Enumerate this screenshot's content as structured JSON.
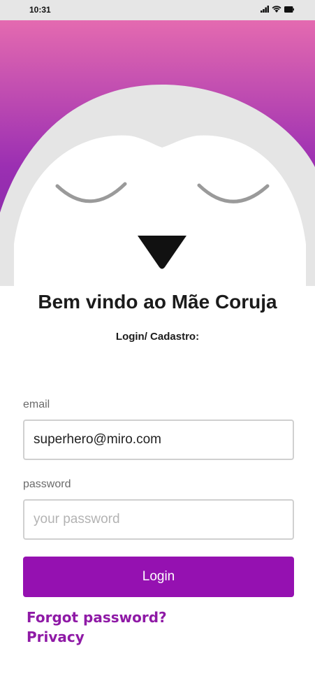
{
  "status_bar": {
    "time": "10:31",
    "icons": [
      "signal-icon",
      "wifi-icon",
      "battery-icon"
    ]
  },
  "hero": {
    "description_icon": "owl-face-illustration",
    "colors": {
      "gradient_top": "#e46ab0",
      "gradient_bottom": "#8a24a8",
      "face": "#e5e5e5",
      "beak": "#111111"
    }
  },
  "title": "Bem vindo ao Mãe Coruja",
  "subtitle": "Login/ Cadastro:",
  "form": {
    "email_label": "email",
    "email_value": "superhero@miro.com",
    "password_label": "password",
    "password_placeholder": "your password",
    "login_label": "Login"
  },
  "links": {
    "forgot": "Forgot password?",
    "privacy": "Privacy"
  },
  "colors": {
    "accent": "#9511b1",
    "link": "#8f1aa6"
  }
}
